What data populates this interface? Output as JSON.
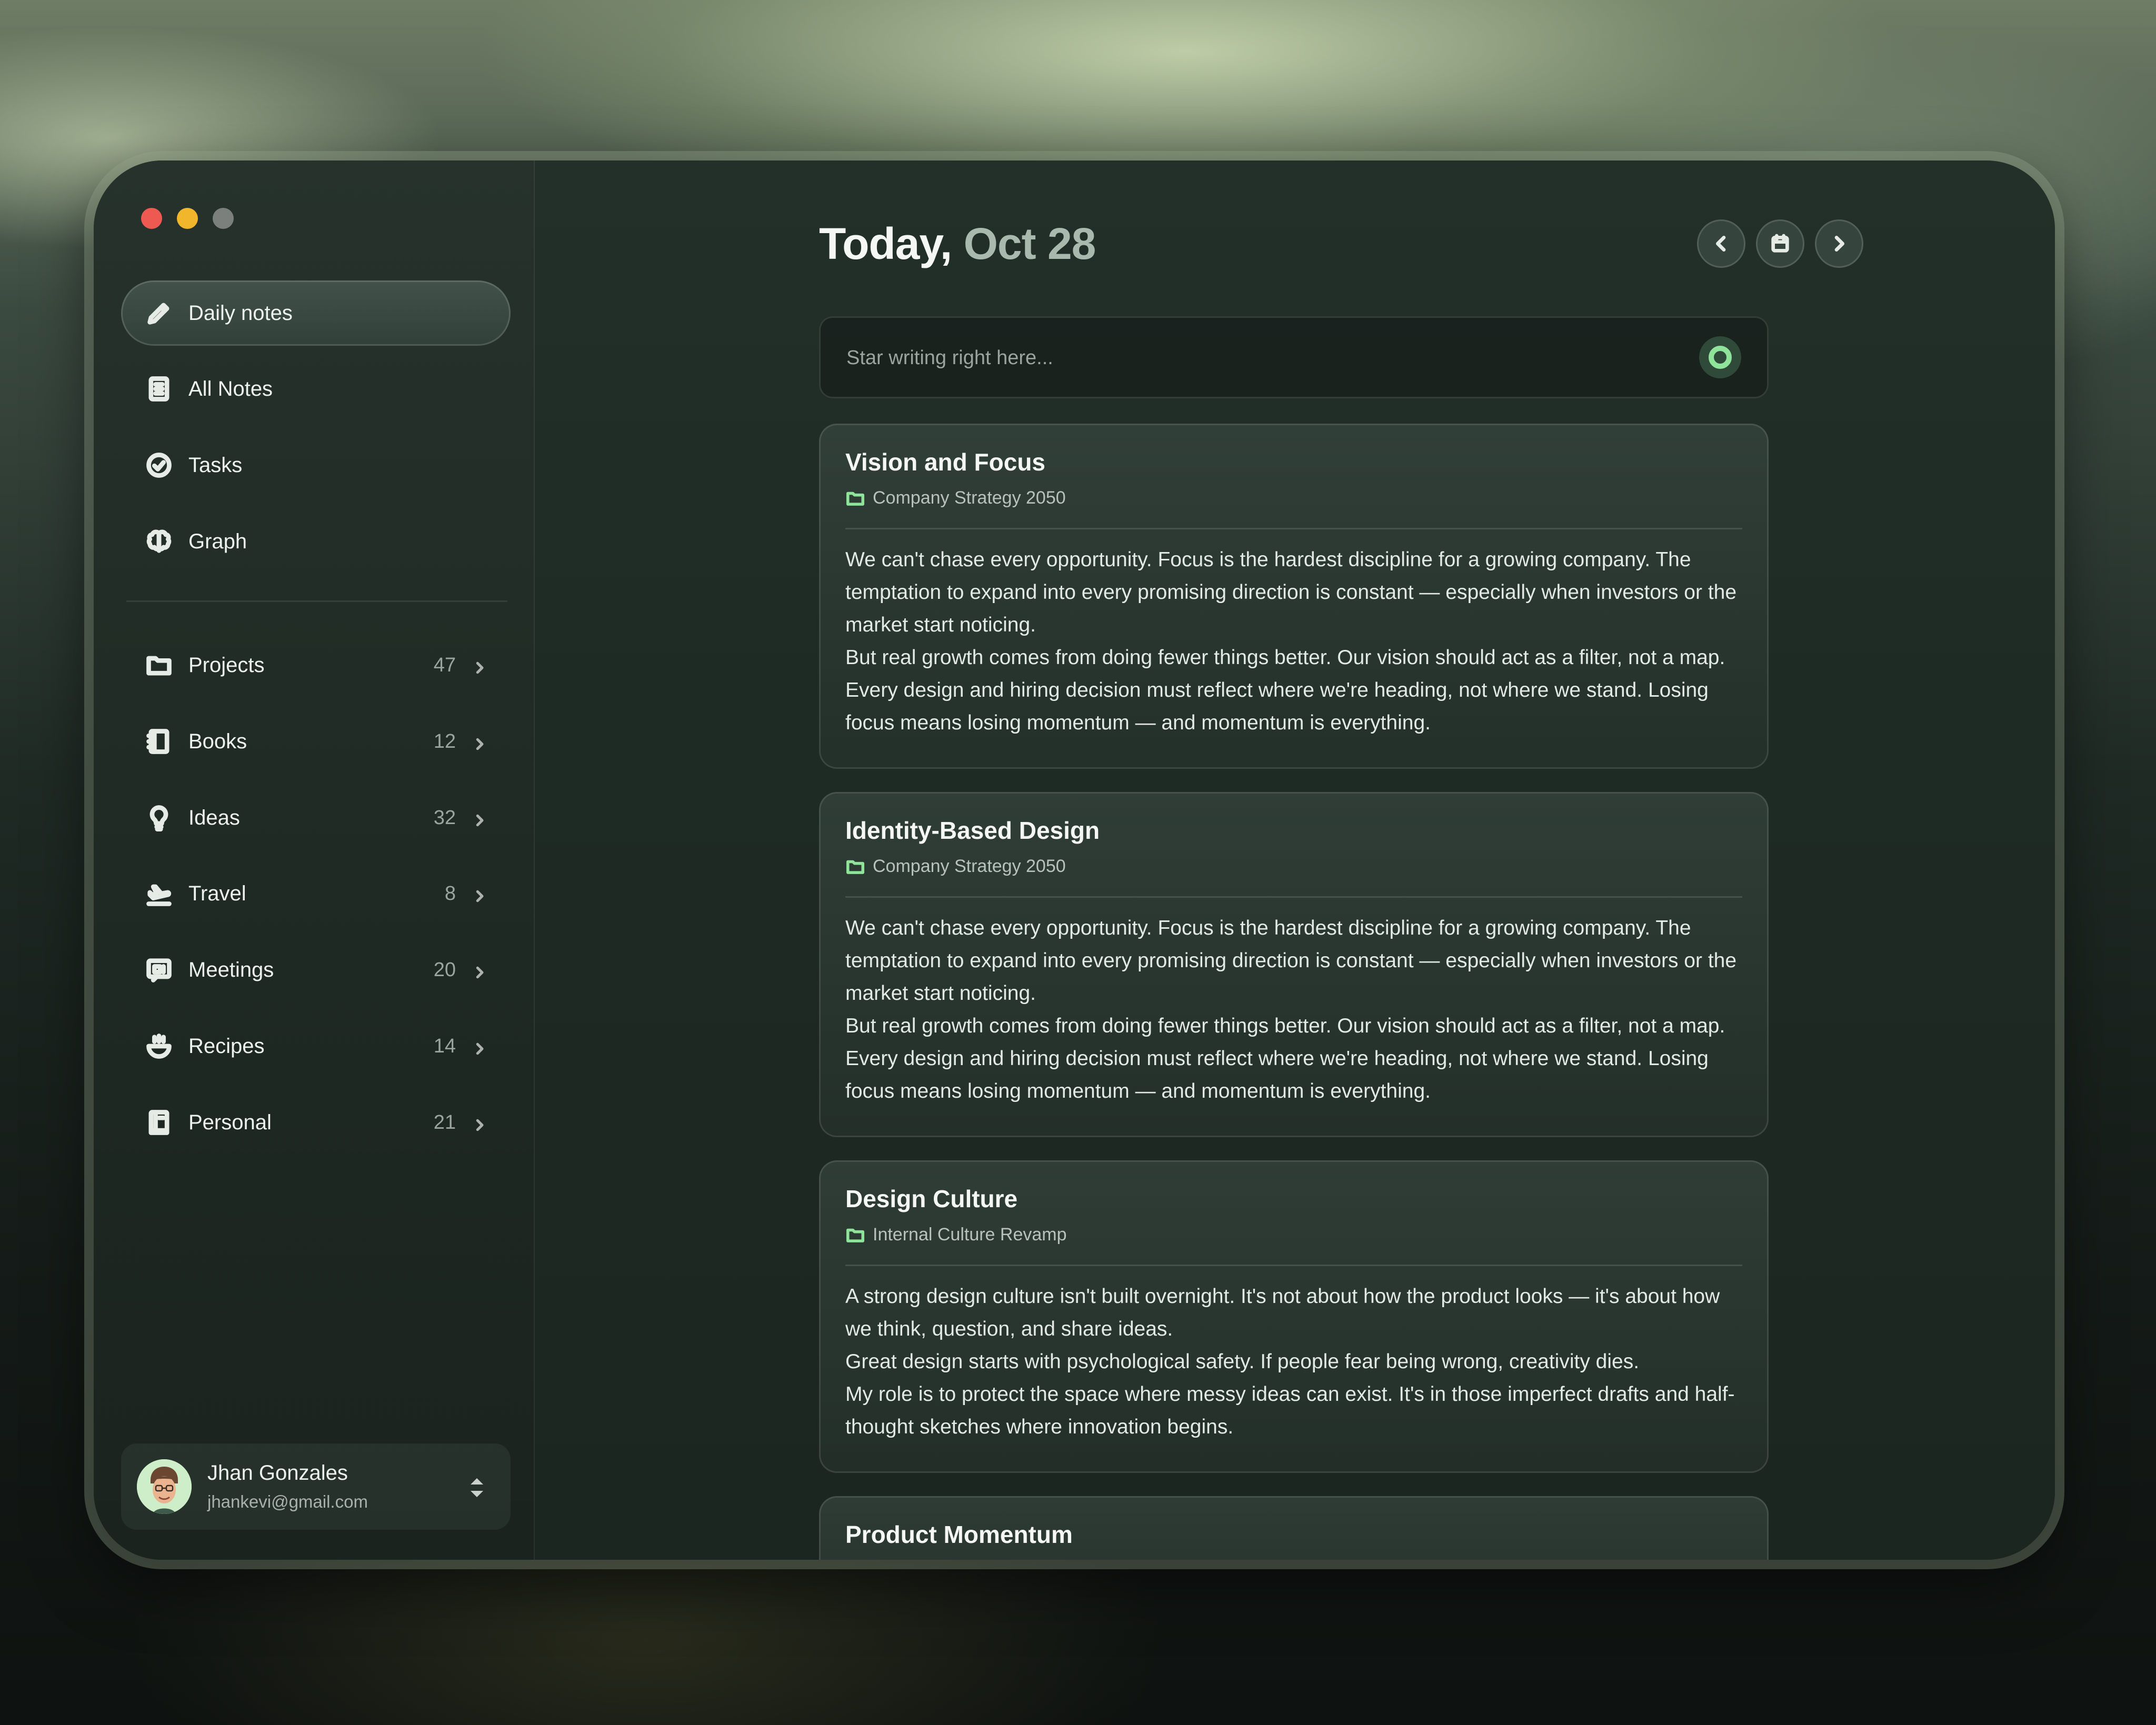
{
  "window": {
    "traffic_lights": [
      "close",
      "minimize",
      "zoom"
    ]
  },
  "sidebar": {
    "primary": [
      {
        "label": "Daily notes",
        "icon": "pencil-icon",
        "active": true
      },
      {
        "label": "All Notes",
        "icon": "document-icon",
        "active": false
      },
      {
        "label": "Tasks",
        "icon": "check-circle-icon",
        "active": false
      },
      {
        "label": "Graph",
        "icon": "brain-icon",
        "active": false
      }
    ],
    "folders": [
      {
        "label": "Projects",
        "count": "47",
        "icon": "folder-icon"
      },
      {
        "label": "Books",
        "count": "12",
        "icon": "book-icon"
      },
      {
        "label": "Ideas",
        "count": "32",
        "icon": "lightbulb-icon"
      },
      {
        "label": "Travel",
        "count": "8",
        "icon": "plane-icon"
      },
      {
        "label": "Meetings",
        "count": "20",
        "icon": "video-icon"
      },
      {
        "label": "Recipes",
        "count": "14",
        "icon": "bowl-icon"
      },
      {
        "label": "Personal",
        "count": "21",
        "icon": "notebook-icon"
      }
    ],
    "user": {
      "name": "Jhan Gonzales",
      "email": "jhankevi@gmail.com"
    }
  },
  "header": {
    "today": "Today,",
    "date": "Oct 28",
    "prev_icon": "chevron-left-icon",
    "calendar_icon": "calendar-icon",
    "next_icon": "chevron-right-icon"
  },
  "composer": {
    "placeholder": "Star writing right here...",
    "value": ""
  },
  "notes": [
    {
      "title": "Vision and Focus",
      "folder": "Company Strategy 2050",
      "paragraphs": [
        "We can't chase every opportunity. Focus is the hardest discipline for a growing company. The temptation to expand into every promising direction is constant — especially when investors or the market start noticing.",
        "But real growth comes from doing fewer things better. Our vision should act as a filter, not a map. Every design and hiring decision must reflect where we're heading, not where we stand. Losing focus means losing momentum — and momentum is everything."
      ]
    },
    {
      "title": "Identity-Based Design",
      "folder": "Company Strategy 2050",
      "paragraphs": [
        "We can't chase every opportunity. Focus is the hardest discipline for a growing company. The temptation to expand into every promising direction is constant — especially when investors or the market start noticing.",
        "But real growth comes from doing fewer things better. Our vision should act as a filter, not a map. Every design and hiring decision must reflect where we're heading, not where we stand. Losing focus means losing momentum — and momentum is everything."
      ]
    },
    {
      "title": "Design Culture",
      "folder": "Internal Culture Revamp",
      "paragraphs": [
        "A strong design culture isn't built overnight. It's not about how the product looks — it's about how we think, question, and share ideas.",
        "Great design starts with psychological safety. If people fear being wrong, creativity dies.",
        "My role is to protect the space where messy ideas can exist. It's in those imperfect drafts and half-thought sketches where innovation begins."
      ]
    },
    {
      "title": "Product Momentum",
      "folder": "",
      "paragraphs": []
    }
  ],
  "colors": {
    "accent": "#8fe39a",
    "close": "#ee5a52",
    "minimize": "#f2b62c",
    "zoom": "#7c807d"
  }
}
